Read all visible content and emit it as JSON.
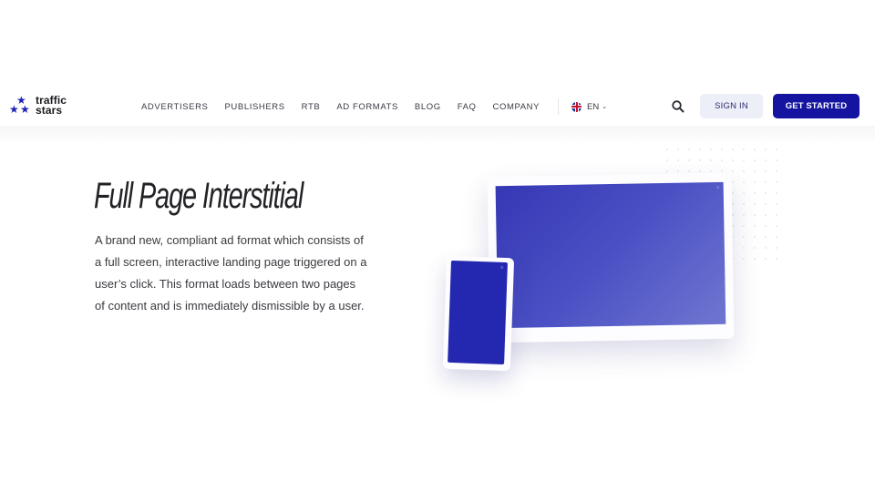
{
  "brand": {
    "name_line1": "traffic",
    "name_line2": "stars",
    "logo_icon": "three-stars-icon",
    "accent_color": "#1414a0"
  },
  "nav": {
    "items": [
      {
        "label": "ADVERTISERS"
      },
      {
        "label": "PUBLISHERS"
      },
      {
        "label": "RTB"
      },
      {
        "label": "AD FORMATS"
      },
      {
        "label": "BLOG"
      },
      {
        "label": "FAQ"
      },
      {
        "label": "COMPANY"
      }
    ],
    "language": {
      "label": "EN",
      "flag_icon": "uk-flag-icon",
      "chevron_icon": "chevron-down-icon"
    }
  },
  "actions": {
    "search_icon": "search-icon",
    "sign_in_label": "SIGN IN",
    "get_started_label": "GET STARTED"
  },
  "hero": {
    "title": "Full Page Interstitial",
    "description": "A brand new, compliant ad format which consists of a full screen, interactive landing page triggered on a user’s click. This format loads between two pages of content and is immediately dismissible by a user.",
    "illustration": {
      "tablet_close_glyph": "×",
      "phone_close_glyph": "×",
      "screen_color": "#2428b0"
    }
  }
}
